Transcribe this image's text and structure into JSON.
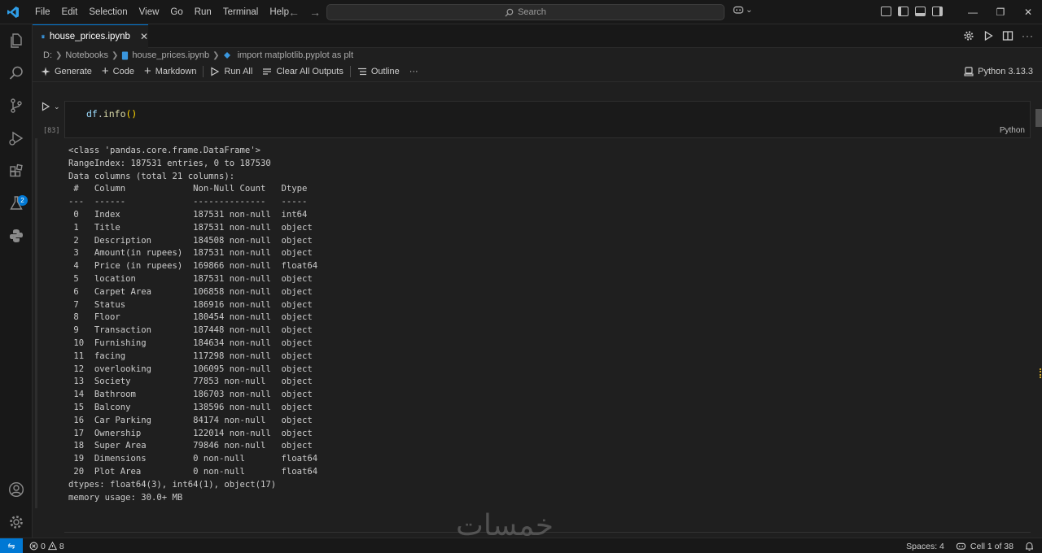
{
  "menu": [
    "File",
    "Edit",
    "Selection",
    "View",
    "Go",
    "Run",
    "Terminal",
    "Help"
  ],
  "search": {
    "placeholder": "Search"
  },
  "tab": {
    "label": "house_prices.ipynb"
  },
  "breadcrumb": {
    "drive": "D:",
    "folder": "Notebooks",
    "file": "house_prices.ipynb",
    "cell": "import matplotlib.pyplot as plt"
  },
  "toolbar": {
    "generate": "Generate",
    "code": "Code",
    "markdown": "Markdown",
    "run_all": "Run All",
    "clear_outputs": "Clear All Outputs",
    "outline": "Outline",
    "more": "···",
    "kernel": "Python 3.13.3"
  },
  "cell": {
    "execution_count": "[83]",
    "code_var": "df",
    "code_dot": ".",
    "code_fn": "info",
    "code_parens": "()",
    "language": "Python"
  },
  "output": {
    "header": [
      "<class 'pandas.core.frame.DataFrame'>",
      "RangeIndex: 187531 entries, 0 to 187530",
      "Data columns (total 21 columns):",
      " #   Column             Non-Null Count   Dtype  ",
      "---  ------             --------------   -----  "
    ],
    "rows": [
      " 0   Index              187531 non-null  int64  ",
      " 1   Title              187531 non-null  object ",
      " 2   Description        184508 non-null  object ",
      " 3   Amount(in rupees)  187531 non-null  object ",
      " 4   Price (in rupees)  169866 non-null  float64",
      " 5   location           187531 non-null  object ",
      " 6   Carpet Area        106858 non-null  object ",
      " 7   Status             186916 non-null  object ",
      " 8   Floor              180454 non-null  object ",
      " 9   Transaction        187448 non-null  object ",
      " 10  Furnishing         184634 non-null  object ",
      " 11  facing             117298 non-null  object ",
      " 12  overlooking        106095 non-null  object ",
      " 13  Society            77853 non-null   object ",
      " 14  Bathroom           186703 non-null  object ",
      " 15  Balcony            138596 non-null  object ",
      " 16  Car Parking        84174 non-null   object ",
      " 17  Ownership          122014 non-null  object ",
      " 18  Super Area         79846 non-null   object ",
      " 19  Dimensions         0 non-null       float64",
      " 20  Plot Area          0 non-null       float64"
    ],
    "footer": [
      "dtypes: float64(3), int64(1), object(17)",
      "memory usage: 30.0+ MB"
    ]
  },
  "watermark": "خمسات",
  "status": {
    "errors": "0",
    "warnings": "8",
    "spaces": "Spaces: 4",
    "cell_position": "Cell 1 of 38"
  },
  "activity_badge": "2",
  "colors": {
    "accent": "#0078d4",
    "background": "#1f1f1f",
    "bar": "#181818"
  }
}
